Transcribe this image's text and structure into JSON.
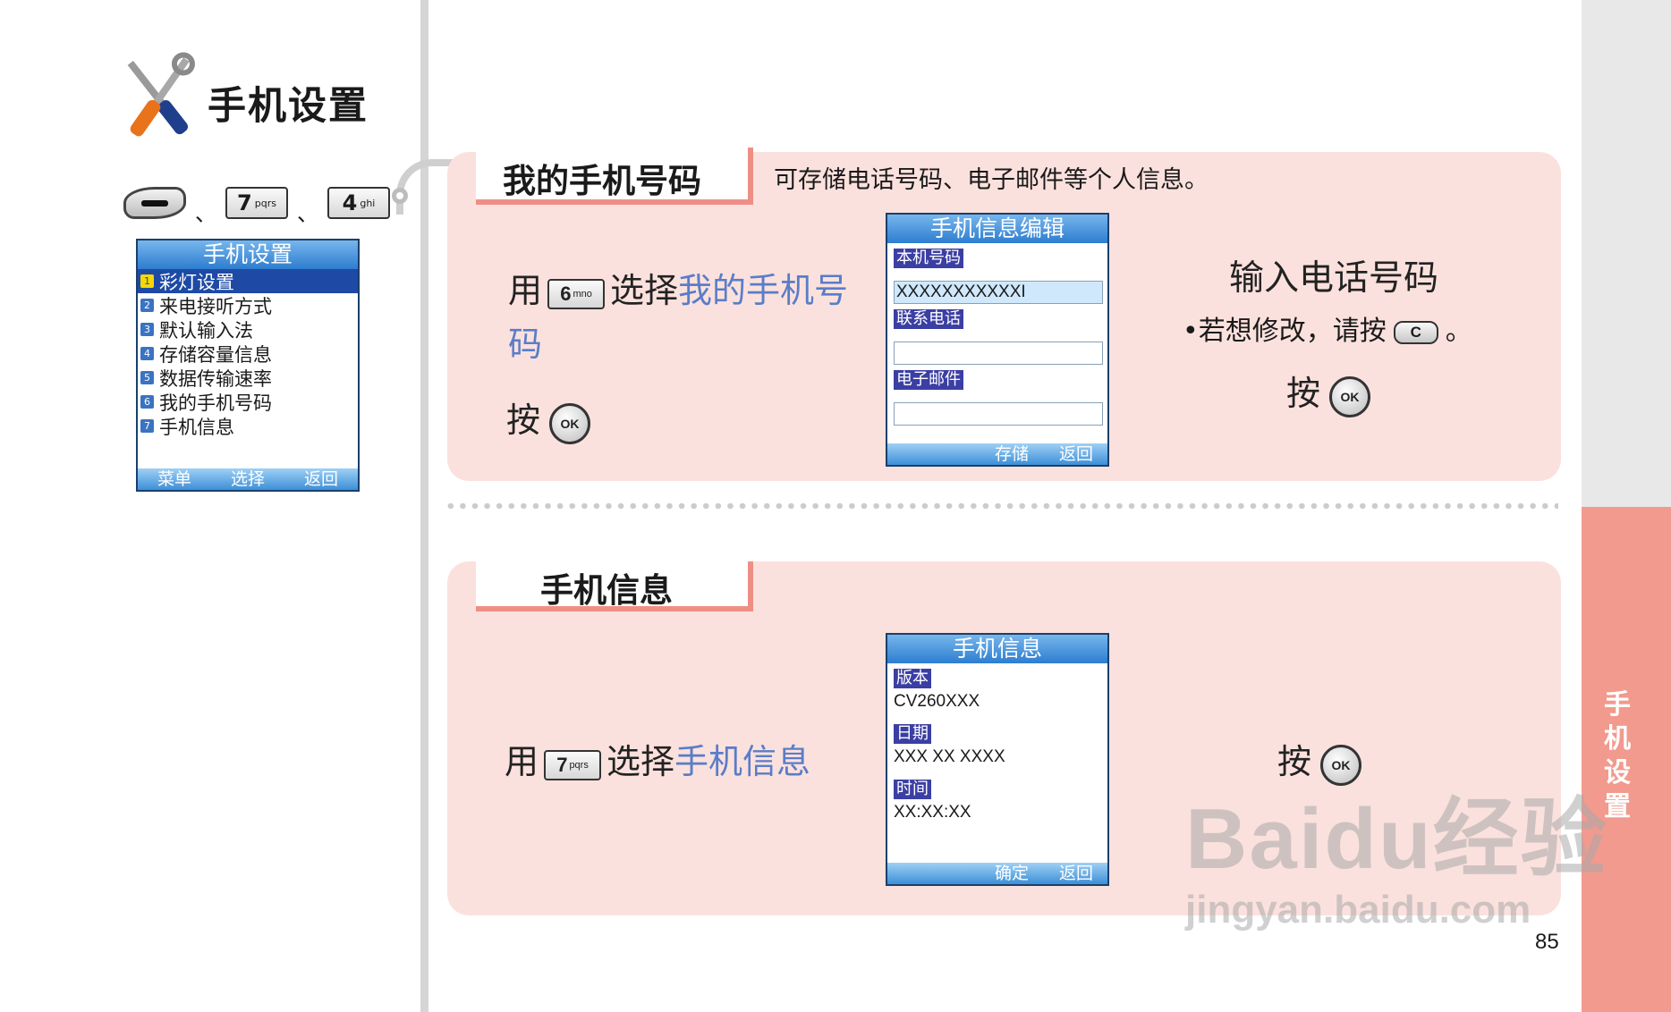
{
  "page": {
    "title": "手机设置",
    "page_number": "85",
    "side_tab": "手机设置",
    "separator": "、"
  },
  "key_sequence": [
    "7",
    "4"
  ],
  "key_sublabels": {
    "7": "pqrs",
    "4": "ghi",
    "6": "mno"
  },
  "menu_screen": {
    "title": "手机设置",
    "items": [
      {
        "num": "1",
        "label": "彩灯设置"
      },
      {
        "num": "2",
        "label": "来电接听方式"
      },
      {
        "num": "3",
        "label": "默认输入法"
      },
      {
        "num": "4",
        "label": "存储容量信息"
      },
      {
        "num": "5",
        "label": "数据传输速率"
      },
      {
        "num": "6",
        "label": "我的手机号码"
      },
      {
        "num": "7",
        "label": "手机信息"
      }
    ],
    "softkeys": [
      "菜单",
      "选择",
      "返回"
    ]
  },
  "section1": {
    "heading": "我的手机号码",
    "description": "可存储电话号码、电子邮件等个人信息。",
    "instr_use": "用",
    "instr_key": "6",
    "instr_select": "选择",
    "instr_target": "我的手机号码",
    "instr_press": "按",
    "ok_label": "OK",
    "screen": {
      "title": "手机信息编辑",
      "fields": [
        {
          "label": "本机号码",
          "value": "XXXXXXXXXXXI"
        },
        {
          "label": "联系电话",
          "value": ""
        },
        {
          "label": "电子邮件",
          "value": ""
        }
      ],
      "softkeys": [
        "存储",
        "返回"
      ]
    },
    "right_title": "输入电话号码",
    "right_bullet_pre": "•若想修改，请按",
    "right_bullet_key": "C",
    "right_bullet_post": "。",
    "right_press": "按"
  },
  "section2": {
    "heading": "手机信息",
    "instr_use": "用",
    "instr_key": "7",
    "instr_select": "选择",
    "instr_target": "手机信息",
    "instr_press": "按",
    "ok_label": "OK",
    "screen": {
      "title": "手机信息",
      "fields": [
        {
          "label": "版本",
          "value": "CV260XXX"
        },
        {
          "label": "日期",
          "value": "XXX XX XXXX"
        },
        {
          "label": "时间",
          "value": "XX:XX:XX"
        }
      ],
      "softkeys": [
        "确定",
        "返回"
      ]
    }
  },
  "watermark": {
    "line1": "Baidu经验",
    "line2": "jingyan.baidu.com"
  }
}
